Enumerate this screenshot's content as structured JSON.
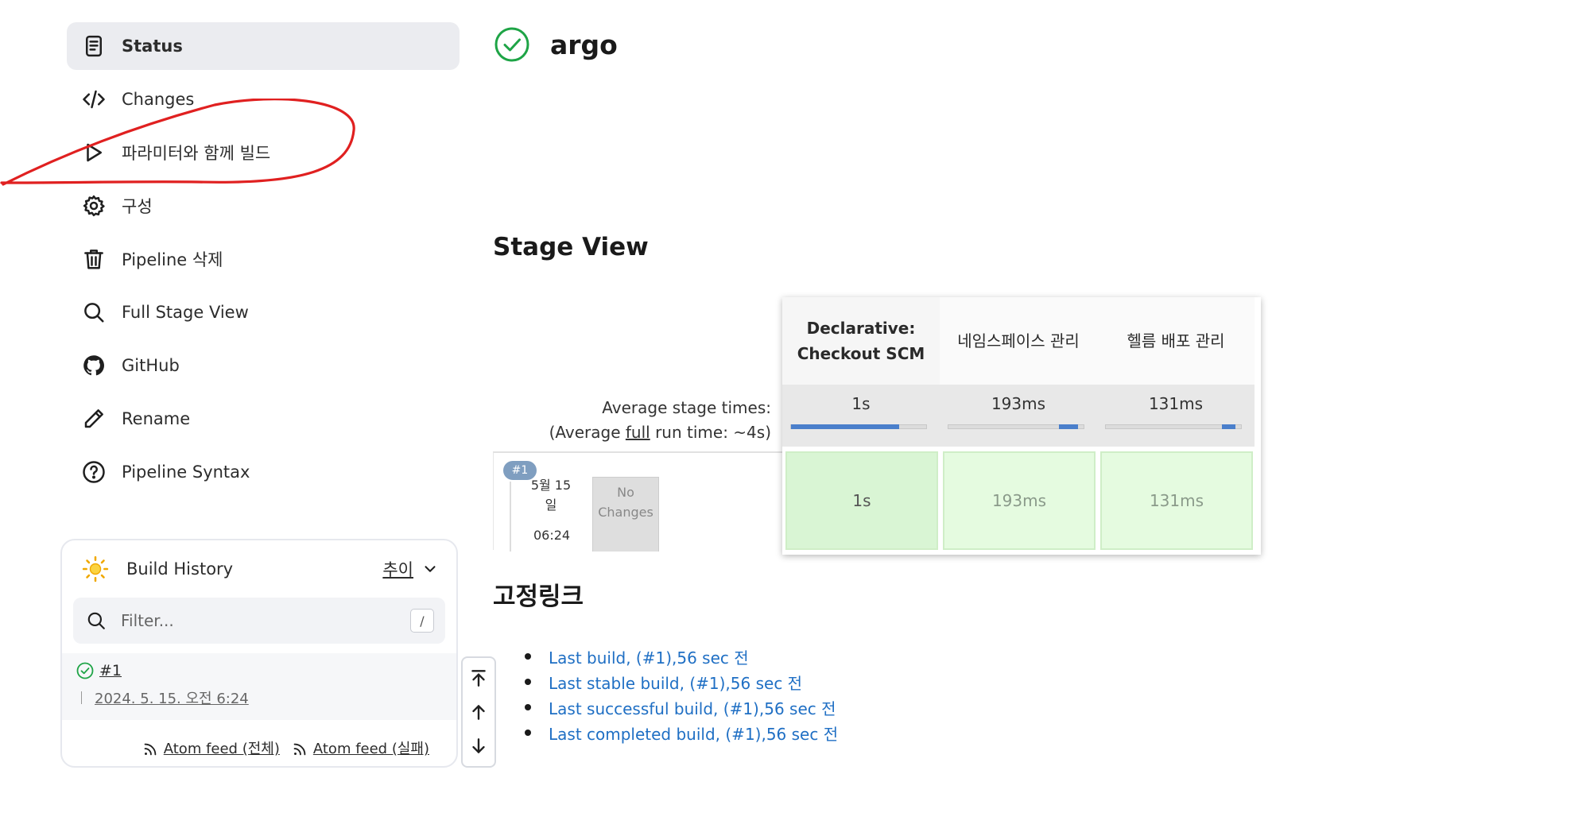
{
  "sidenav": {
    "items": [
      {
        "label": "Status",
        "icon": "status-doc-icon",
        "active": true
      },
      {
        "label": "Changes",
        "icon": "code-icon"
      },
      {
        "label": "파라미터와 함께 빌드",
        "icon": "play-icon"
      },
      {
        "label": "구성",
        "icon": "gear-icon"
      },
      {
        "label": "Pipeline 삭제",
        "icon": "trash-icon"
      },
      {
        "label": "Full Stage View",
        "icon": "search-icon"
      },
      {
        "label": "GitHub",
        "icon": "github-icon"
      },
      {
        "label": "Rename",
        "icon": "pencil-icon"
      },
      {
        "label": "Pipeline Syntax",
        "icon": "question-icon"
      }
    ]
  },
  "annotation": {
    "color": "#e02020"
  },
  "build_history": {
    "title": "Build History",
    "trend_label": "추이",
    "filter_placeholder": "Filter...",
    "shortcut": "/",
    "builds": [
      {
        "number": "#1",
        "date": "2024. 5. 15. 오전 6:24",
        "status": "success"
      }
    ],
    "feeds": [
      "Atom feed (전체)",
      "Atom feed (실패)"
    ]
  },
  "job": {
    "name": "argo",
    "status": "success",
    "status_color": "#1ea446"
  },
  "stage_view": {
    "heading": "Stage View",
    "avg_label": "Average stage times:",
    "avg_full_prefix": "(Average ",
    "avg_full_link": "full",
    "avg_full_suffix": " run time: ~4s)",
    "stages": [
      {
        "name": "Declarative: Checkout SCM",
        "avg": "1s",
        "avg_fraction": 0.8,
        "cell": "1s"
      },
      {
        "name": "네임스페이스 관리",
        "avg": "193ms",
        "avg_fraction": 0.14,
        "cell": "193ms"
      },
      {
        "name": "헬름 배포 관리",
        "avg": "131ms",
        "avg_fraction": 0.1,
        "cell": "131ms"
      }
    ],
    "run": {
      "badge": "#1",
      "date_line1": "5월 15",
      "date_line2": "일",
      "time": "06:24",
      "changes_line1": "No",
      "changes_line2": "Changes"
    }
  },
  "permalinks": {
    "heading": "고정링크",
    "links": [
      "Last build, (#1),56 sec 전",
      "Last stable build, (#1),56 sec 전",
      "Last successful build, (#1),56 sec 전",
      "Last completed build, (#1),56 sec 전"
    ]
  },
  "scroll_buttons": [
    "scroll-top-icon",
    "scroll-up-icon",
    "scroll-down-icon"
  ]
}
